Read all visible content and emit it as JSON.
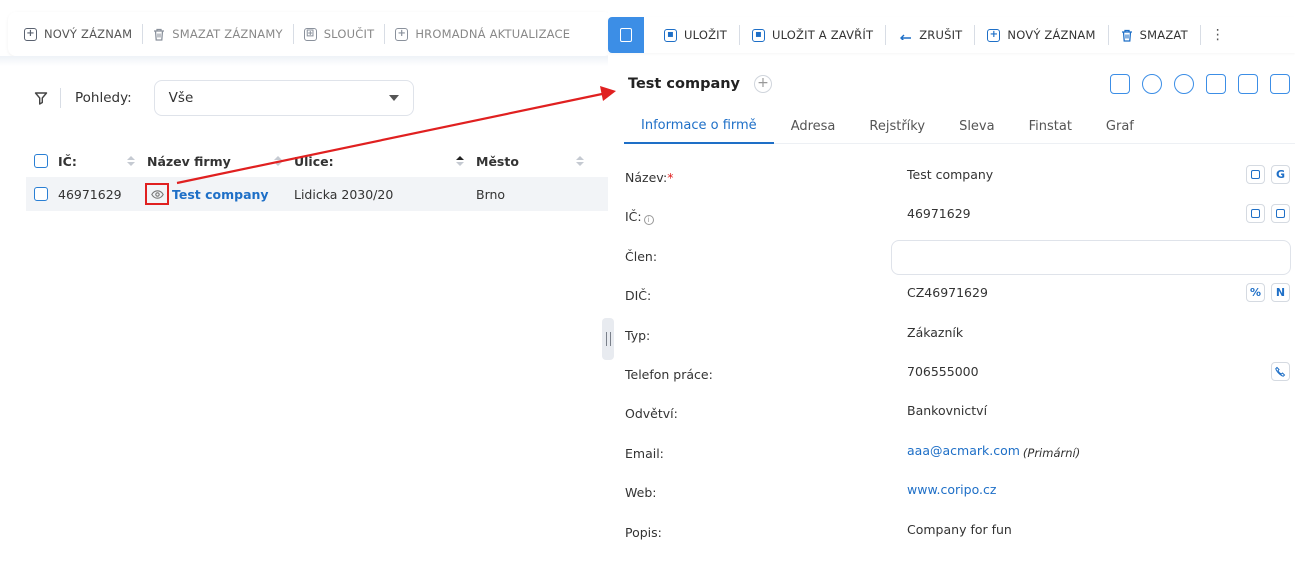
{
  "list_toolbar": {
    "new_record": "NOVÝ ZÁZNAM",
    "delete_records": "SMAZAT ZÁZNAMY",
    "merge": "SLOUČIT",
    "bulk_update": "HROMADNÁ AKTUALIZACE"
  },
  "filter": {
    "label": "Pohledy:",
    "selected": "Vše"
  },
  "table": {
    "columns": [
      "IČ:",
      "Název firmy",
      "Ulice:",
      "Město"
    ],
    "rows": [
      {
        "ic": "46971629",
        "name": "Test company",
        "street": "Lidicka 2030/20",
        "city": "Brno"
      }
    ]
  },
  "detail_toolbar": {
    "save": "ULOŽIT",
    "save_close": "ULOŽIT A ZAVŘÍT",
    "cancel": "ZRUŠIT",
    "new_record": "NOVÝ ZÁZNAM",
    "delete": "SMAZAT",
    "more": "⋮"
  },
  "detail": {
    "title": "Test company",
    "add": "+",
    "tabs": [
      "Informace o firmě",
      "Adresa",
      "Rejstříky",
      "Sleva",
      "Finstat",
      "Graf"
    ],
    "fields": {
      "name_label": "Název:",
      "name_required": "*",
      "name_value": "Test company",
      "ic_label": "IČ:",
      "ic_info": "i",
      "ic_value": "46971629",
      "member_label": "Člen:",
      "dic_label": "DIČ:",
      "dic_value": "CZ46971629",
      "type_label": "Typ:",
      "type_value": "Zákazník",
      "phone_label": "Telefon práce:",
      "phone_value": "706555000",
      "industry_label": "Odvětví:",
      "industry_value": "Bankovnictví",
      "email_label": "Email:",
      "email_value": "aaa@acmark.com",
      "email_note": "(Primární)",
      "web_label": "Web:",
      "web_value": "www.coripo.cz",
      "desc_label": "Popis:",
      "desc_value": "Company for fun"
    },
    "field_icons": {
      "google": "G",
      "percent": "%",
      "n": "N"
    }
  },
  "colors": {
    "accent": "#1e6fc7",
    "accent_light": "#3c8ee6",
    "annotation_red": "#e02020"
  }
}
